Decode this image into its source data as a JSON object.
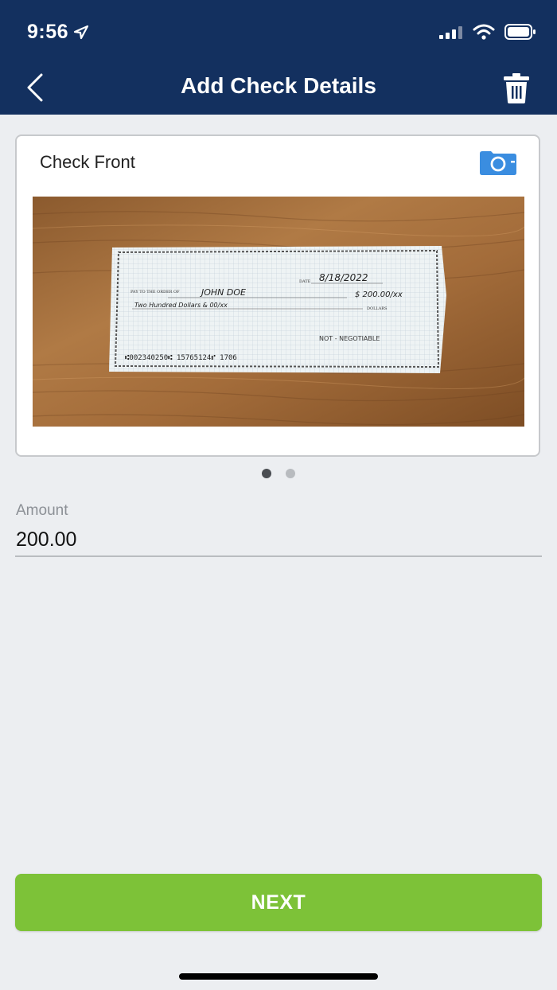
{
  "status_bar": {
    "time": "9:56"
  },
  "header": {
    "title": "Add Check Details"
  },
  "check_card": {
    "title": "Check Front",
    "check": {
      "date": "8/18/2022",
      "payee": "JOHN DOE",
      "amount_box": "$ 200.00/xx",
      "written_amount": "Two Hundred Dollars & 00/xx",
      "not_negotiable": "NOT - NEGOTIABLE",
      "micr": "⑆002340250⑆ 15765124⑈ 1706",
      "pay_to_the_order_of": "PAY TO THE ORDER OF",
      "dollars": "DOLLARS",
      "date_label": "DATE"
    }
  },
  "pagination": {
    "total": 2,
    "active_index": 0
  },
  "amount_field": {
    "label": "Amount",
    "value": "200.00"
  },
  "next_button": {
    "label": "NEXT"
  },
  "colors": {
    "header_bg": "#13305f",
    "accent": "#3a8de0",
    "next_bg": "#7dc238"
  }
}
